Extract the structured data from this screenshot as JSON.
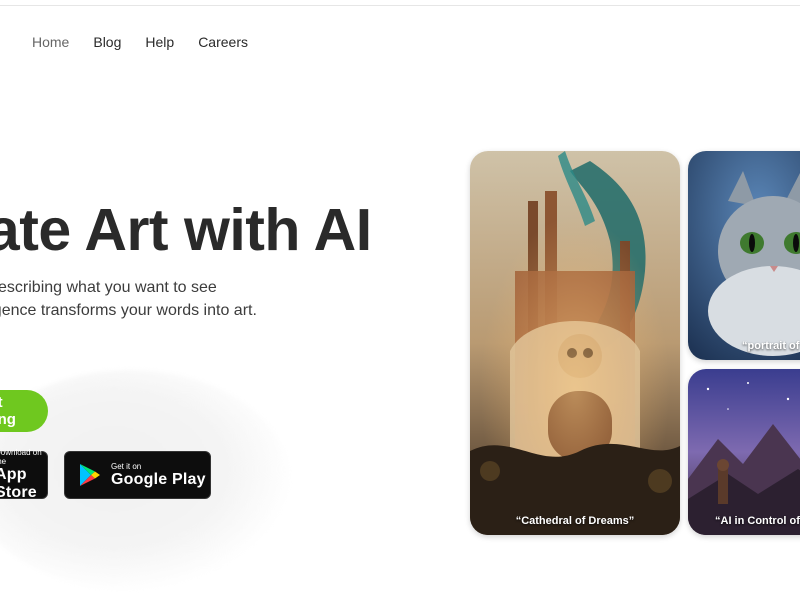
{
  "nav": {
    "items": [
      {
        "label": "Home",
        "active": true
      },
      {
        "label": "Blog",
        "active": false
      },
      {
        "label": "Help",
        "active": false
      },
      {
        "label": "Careers",
        "active": false
      }
    ]
  },
  "hero": {
    "title": "Create Art with AI",
    "subtitle_line1": "simply by describing what you want to see",
    "subtitle_line2": "Artificial Intelligence transforms your words into art.",
    "cta_label": "Start Creating",
    "accent_color": "#6fc81f"
  },
  "stores": {
    "apple": {
      "small": "Download on the",
      "big": "App Store"
    },
    "google": {
      "small": "Get it on",
      "big": "Google Play"
    }
  },
  "gallery": {
    "cards": [
      {
        "caption": "“Cathedral of Dreams”"
      },
      {
        "caption": "“portrait of a cat”"
      },
      {
        "caption": "“AI in Control of the Universe”"
      }
    ]
  }
}
